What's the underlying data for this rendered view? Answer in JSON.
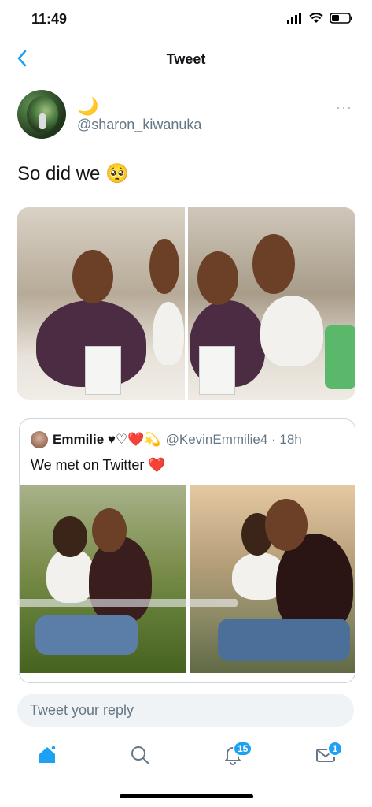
{
  "status_bar": {
    "time": "11:49"
  },
  "nav": {
    "title": "Tweet"
  },
  "tweet": {
    "display_name": "🌙",
    "handle": "@sharon_kiwanuka",
    "more_label": "···",
    "text": "So did we 🥺"
  },
  "quote": {
    "name": "Emmilie ♥♡❤️💫",
    "handle": "@KevinEmmilie4 · 18h",
    "text": "We met on Twitter ❤️"
  },
  "reply": {
    "placeholder": "Tweet your reply"
  },
  "tabs": {
    "notifications_badge": "15",
    "messages_badge": "1"
  },
  "colors": {
    "accent": "#1da1f2",
    "text": "#14171a",
    "secondary": "#657786"
  }
}
